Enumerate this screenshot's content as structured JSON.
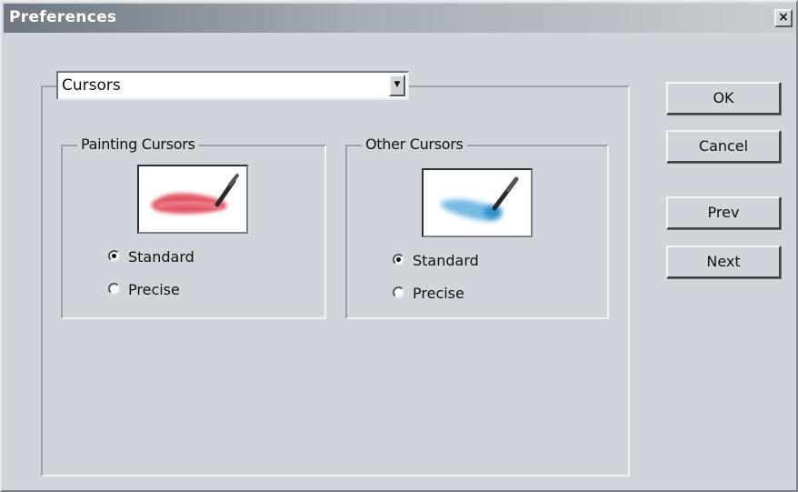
{
  "window": {
    "title": "Preferences",
    "close_glyph": "×"
  },
  "category_select": {
    "value": "Cursors",
    "arrow_glyph": "▼"
  },
  "painting_cursors": {
    "legend": "Painting Cursors",
    "preview_icon": "red-brush-stroke-icon",
    "options": [
      {
        "label": "Standard",
        "checked": true
      },
      {
        "label": "Precise",
        "checked": false
      }
    ],
    "stroke_color": "#e0505f"
  },
  "other_cursors": {
    "legend": "Other Cursors",
    "preview_icon": "blue-eyedropper-icon",
    "options": [
      {
        "label": "Standard",
        "checked": true
      },
      {
        "label": "Precise",
        "checked": false
      }
    ],
    "stroke_color": "#4aa3d8"
  },
  "buttons": {
    "ok": "OK",
    "cancel": "Cancel",
    "prev": "Prev",
    "next": "Next"
  }
}
